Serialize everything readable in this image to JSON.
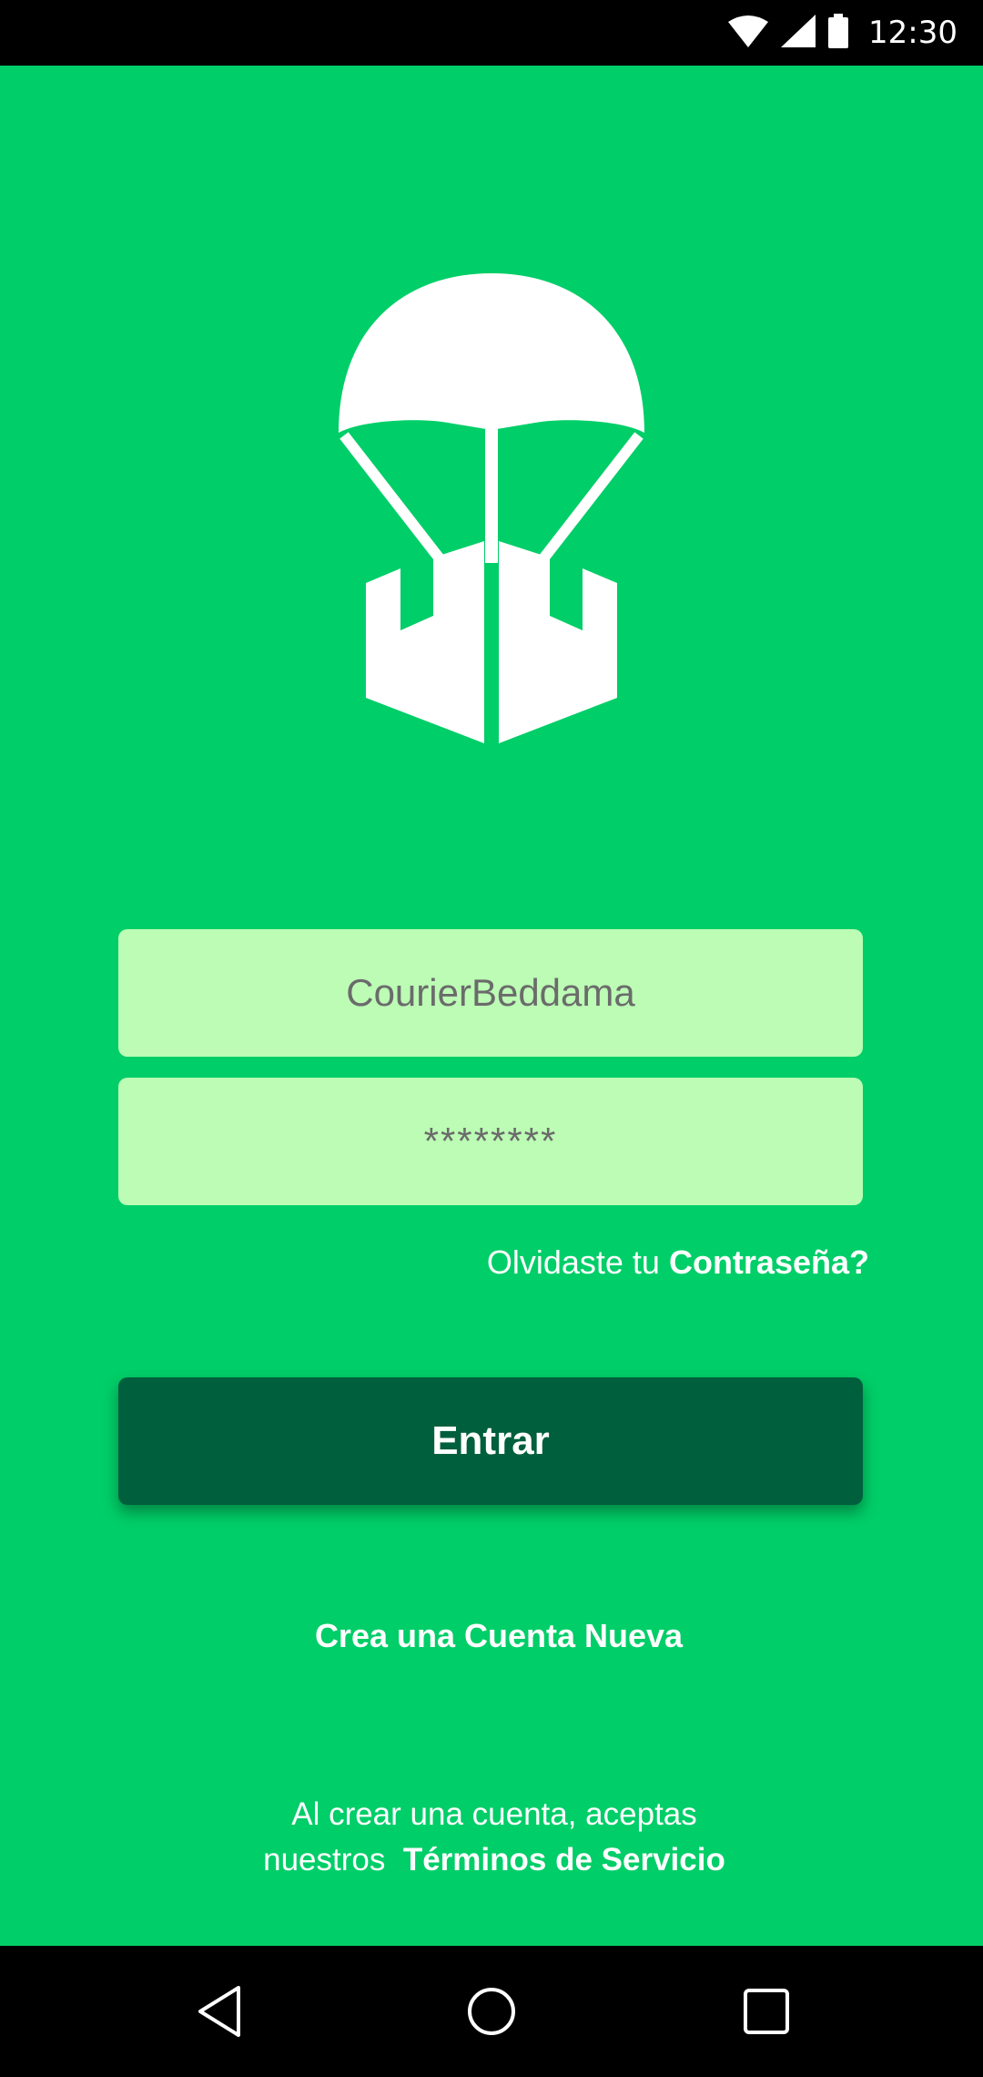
{
  "status_bar": {
    "time": "12:30",
    "icons": [
      "wifi-icon",
      "cell-signal-icon",
      "battery-icon"
    ]
  },
  "colors": {
    "background": "#00CE68",
    "input_fill": "#BCFCB5",
    "button_fill": "#005F3D",
    "text_light": "#FFFFFF"
  },
  "login": {
    "username_placeholder": "CourierBeddama",
    "password_placeholder": "********",
    "forgot_prefix": "Olvidaste tu ",
    "forgot_link": "Contraseña?",
    "submit_label": "Entrar",
    "create_account": "Crea una Cuenta Nueva",
    "terms_line1": "Al crear una cuenta, aceptas",
    "terms_prefix": "nuestros  ",
    "terms_link": "Términos de Servicio"
  },
  "nav_bar": {
    "buttons": [
      "back-icon",
      "home-icon",
      "recents-icon"
    ]
  }
}
